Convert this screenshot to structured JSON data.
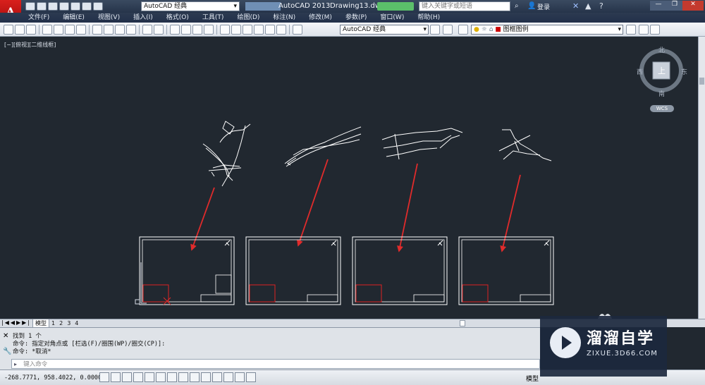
{
  "titlebar": {
    "workspace": "AutoCAD 经典",
    "app_title": "AutoCAD 2013",
    "file_name": "Drawing13.dwg",
    "search_placeholder": "键入关键字或短语",
    "login": "登录"
  },
  "menu": [
    "文件(F)",
    "编辑(E)",
    "视图(V)",
    "插入(I)",
    "格式(O)",
    "工具(T)",
    "绘图(D)",
    "标注(N)",
    "修改(M)",
    "参数(P)",
    "窗口(W)",
    "帮助(H)"
  ],
  "toolbar": {
    "workspace_combo": "AutoCAD 经典",
    "layer_combo": "图框图例"
  },
  "viewport": {
    "label": "[−][俯视][二维线框]",
    "compass": {
      "north": "北",
      "south": "南",
      "east": "东",
      "west": "西",
      "top": "上"
    },
    "wcs": "WCS"
  },
  "tabs": [
    "模型",
    "1",
    "2",
    "3",
    "4"
  ],
  "command": {
    "lines": [
      "找到 1 个",
      "命令: 指定对角点或 [栏选(F)/圈围(WP)/圈交(CP)]:",
      "命令: *取消*"
    ],
    "prompt_placeholder": "键入命令"
  },
  "status": {
    "coords": "-268.7771, 958.4022, 0.0000",
    "model": "模型"
  },
  "watermark": {
    "title": "溜溜自学",
    "url": "ZIXUE.3D66.COM"
  },
  "colors": {
    "canvas": "#212830",
    "arrow": "#e12b2b",
    "drawing_line": "#ffffff"
  }
}
